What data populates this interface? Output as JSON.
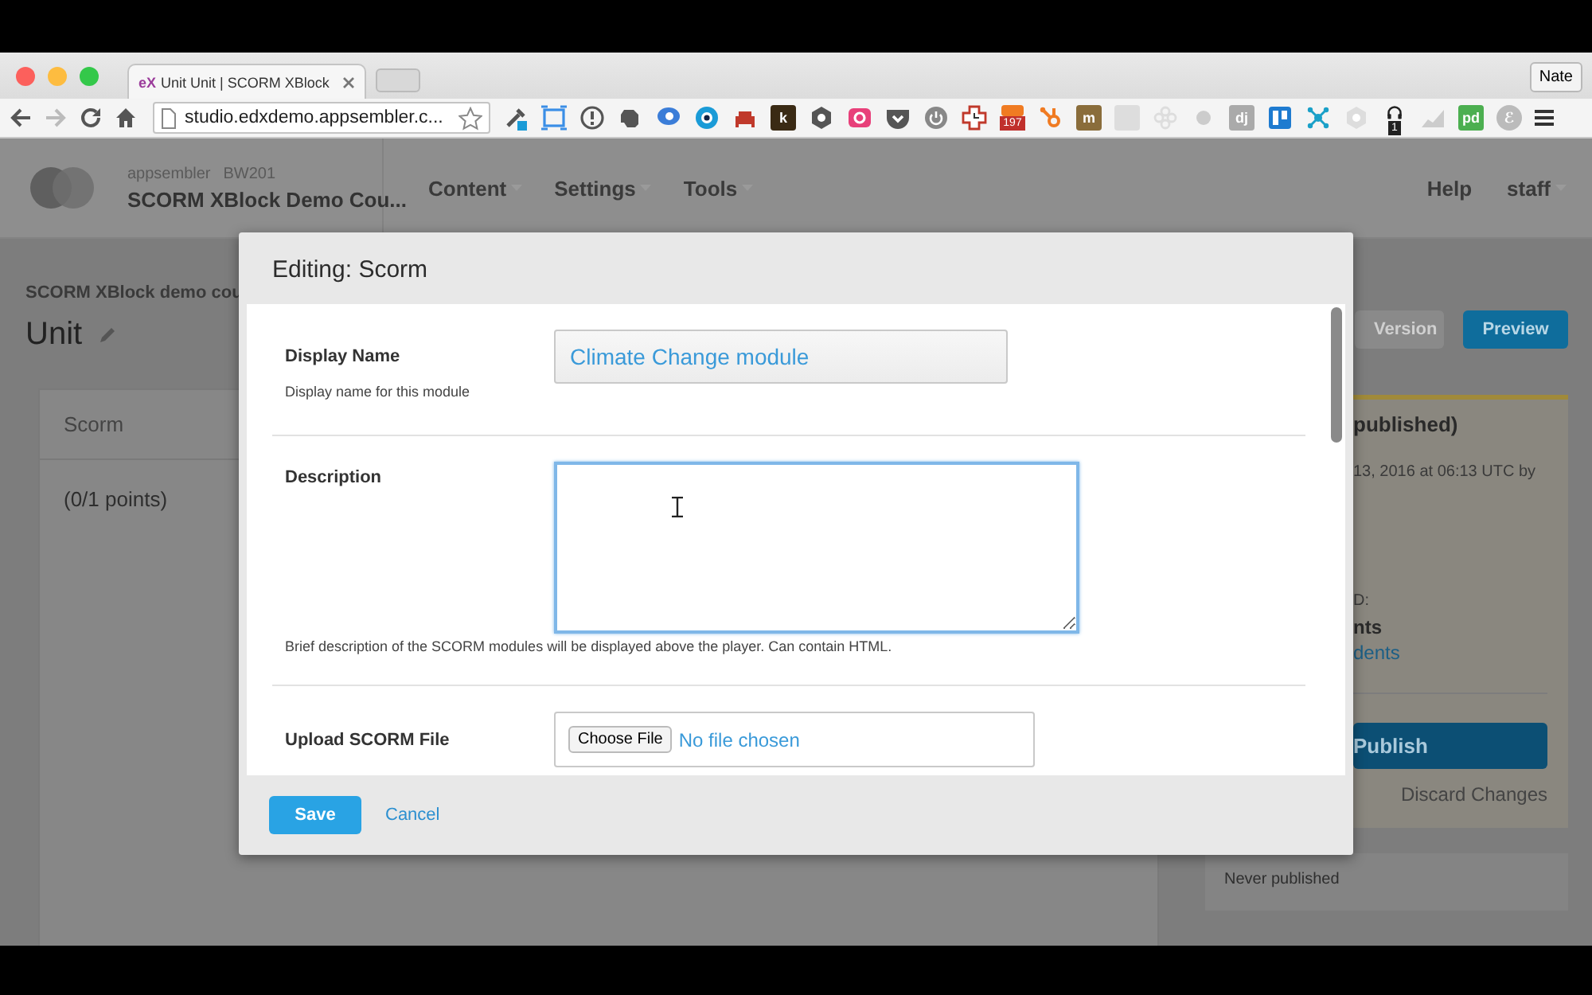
{
  "browser": {
    "tab": {
      "logo": "eX",
      "title": "Unit Unit | SCORM XBlock"
    },
    "profile": "Nate",
    "url": "studio.edxdemo.appsembler.c...",
    "forward_disabled": true,
    "extensions": [
      {
        "kind": "dropper",
        "color": "#1a9bd7"
      },
      {
        "kind": "frame",
        "color": "#3a8ee6"
      },
      {
        "kind": "ring",
        "color": "#555555"
      },
      {
        "kind": "blob",
        "color": "#555555"
      },
      {
        "kind": "bubble",
        "color": "#3b7dd8"
      },
      {
        "kind": "eye",
        "color": "#1a9bd7"
      },
      {
        "kind": "sofa",
        "color": "#c0392b"
      },
      {
        "kind": "tile",
        "color": "#3a2a14",
        "label": "k"
      },
      {
        "kind": "hex",
        "color": "#555555"
      },
      {
        "kind": "camera",
        "color": "#e8407a"
      },
      {
        "kind": "pocket",
        "color": "#555555"
      },
      {
        "kind": "power",
        "color": "#888888"
      },
      {
        "kind": "cross",
        "color": "#c0392b"
      },
      {
        "kind": "tile",
        "color": "#f07b22",
        "badge": "197"
      },
      {
        "kind": "sprocket",
        "color": "#f07b22"
      },
      {
        "kind": "tile",
        "color": "#8a6d3b",
        "label": "m"
      },
      {
        "kind": "tile",
        "color": "#dddddd"
      },
      {
        "kind": "flower",
        "color": "#dddddd"
      },
      {
        "kind": "dot",
        "color": "#cccccc"
      },
      {
        "kind": "tile",
        "color": "#aaaaaa",
        "label": "dj"
      },
      {
        "kind": "trello",
        "color": "#1e7bd0"
      },
      {
        "kind": "network",
        "color": "#1aa0c8"
      },
      {
        "kind": "hex",
        "color": "#dddddd"
      },
      {
        "kind": "headphones",
        "color": "#222222",
        "badge": "1"
      },
      {
        "kind": "trend",
        "color": "#cccccc"
      },
      {
        "kind": "tile",
        "color": "#4caf50",
        "label": "pd"
      },
      {
        "kind": "round",
        "color": "#bbbbbb",
        "label": "ℰ"
      }
    ]
  },
  "header": {
    "org": "appsembler",
    "run": "BW201",
    "course": "SCORM XBlock Demo Cou...",
    "nav": [
      {
        "label": "Content",
        "dropdown": true
      },
      {
        "label": "Settings",
        "dropdown": true
      },
      {
        "label": "Tools",
        "dropdown": true
      }
    ],
    "user_nav": [
      {
        "label": "Help",
        "dropdown": false
      },
      {
        "label": "staff",
        "dropdown": true
      }
    ]
  },
  "page": {
    "breadcrumb": "SCORM XBlock demo cou",
    "title": "Unit",
    "component": {
      "name": "Scorm",
      "points": "(0/1 points)"
    },
    "actions": [
      {
        "kind": "secondary",
        "label": "Version"
      },
      {
        "kind": "primary",
        "label": "Preview"
      }
    ],
    "status": {
      "title": "published)",
      "lines": [
        {
          "kind": "text",
          "text": "13, 2016 at 06:13 UTC by"
        },
        {
          "kind": "label",
          "text": "D:"
        },
        {
          "kind": "bold",
          "text": "nts"
        },
        {
          "kind": "link",
          "text": "dents"
        }
      ],
      "publish": "Publish",
      "discard": "Discard Changes"
    },
    "release": "Never published"
  },
  "modal": {
    "title": "Editing: Scorm",
    "fields": [
      {
        "kind": "text",
        "label": "Display Name",
        "value": "Climate Change module",
        "help": "Display name for this module"
      },
      {
        "kind": "textarea",
        "label": "Description",
        "focused": true,
        "help": "Brief description of the SCORM modules will be displayed above the player. Can contain HTML."
      },
      {
        "kind": "file",
        "label": "Upload SCORM File",
        "button": "Choose File",
        "status": "No file chosen"
      }
    ],
    "save": "Save",
    "cancel": "Cancel"
  }
}
